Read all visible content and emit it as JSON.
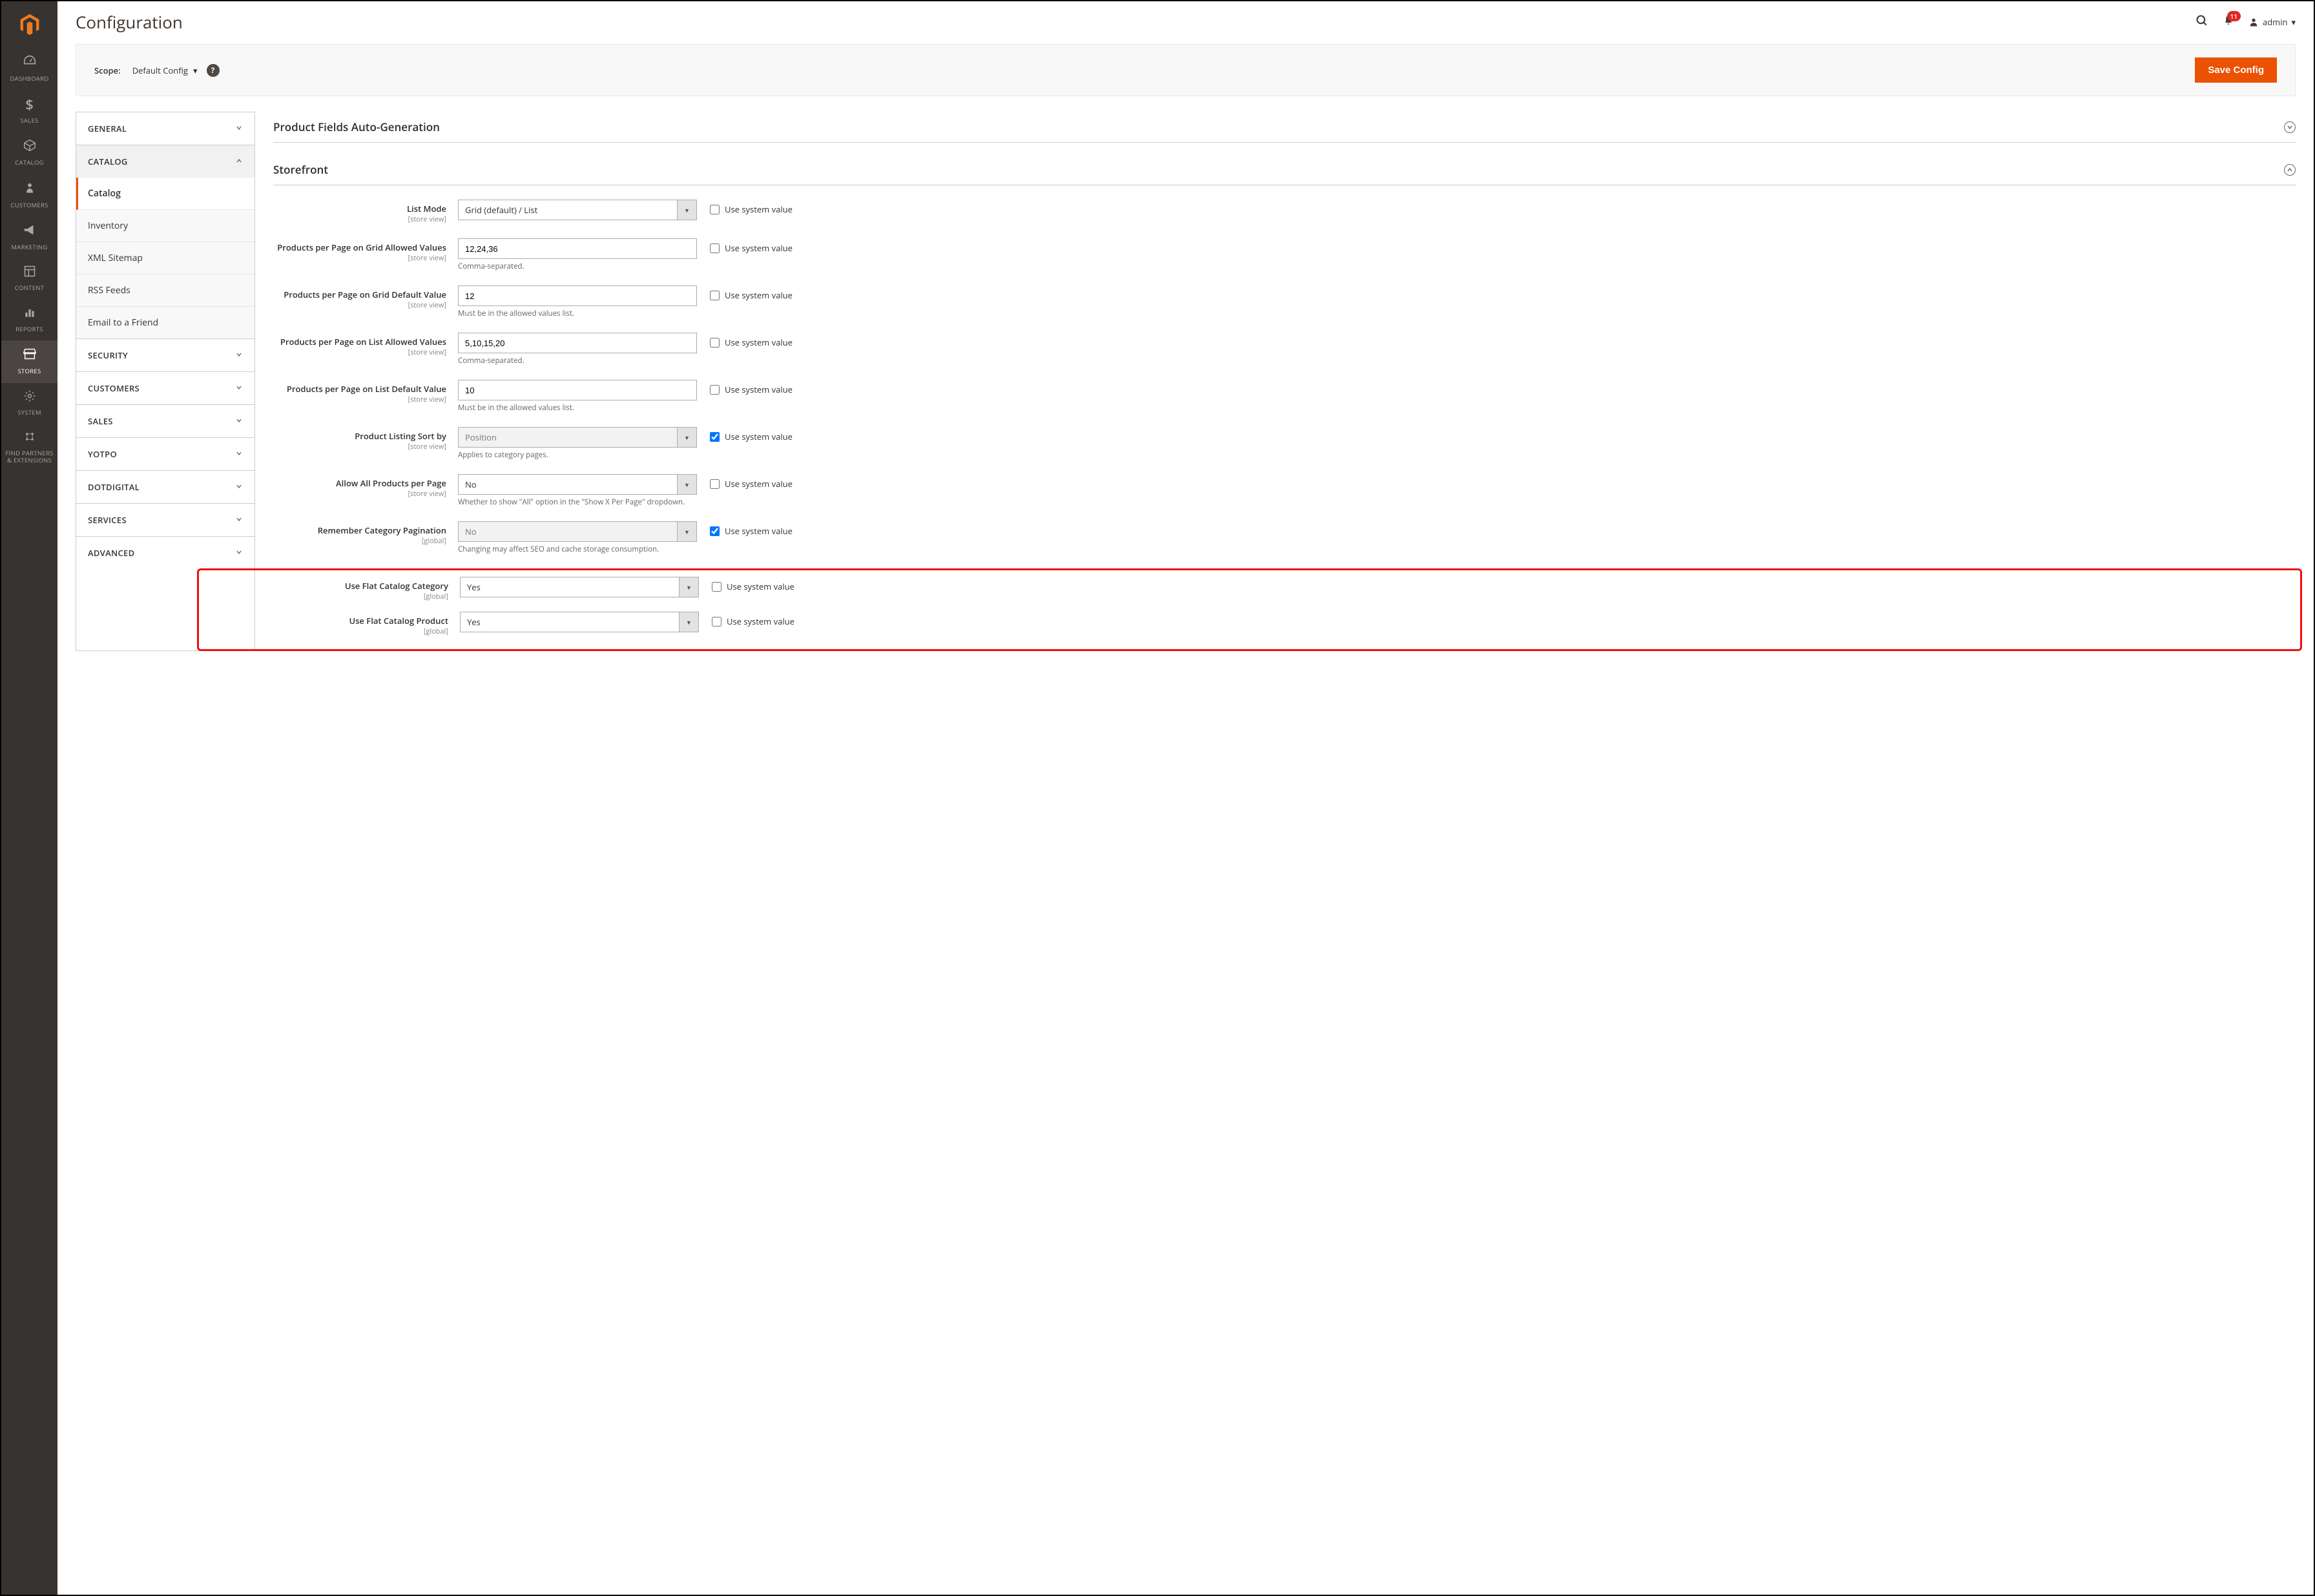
{
  "header": {
    "title": "Configuration",
    "notification_count": "11",
    "admin_label": "admin"
  },
  "scope": {
    "label": "Scope:",
    "value": "Default Config",
    "save_label": "Save Config"
  },
  "sidebar": [
    {
      "key": "dashboard",
      "label": "DASHBOARD"
    },
    {
      "key": "sales",
      "label": "SALES"
    },
    {
      "key": "catalog",
      "label": "CATALOG"
    },
    {
      "key": "customers",
      "label": "CUSTOMERS"
    },
    {
      "key": "marketing",
      "label": "MARKETING"
    },
    {
      "key": "content",
      "label": "CONTENT"
    },
    {
      "key": "reports",
      "label": "REPORTS"
    },
    {
      "key": "stores",
      "label": "STORES",
      "active": true
    },
    {
      "key": "system",
      "label": "SYSTEM"
    },
    {
      "key": "find",
      "label": "FIND PARTNERS & EXTENSIONS"
    }
  ],
  "tabs": [
    {
      "label": "GENERAL",
      "open": false
    },
    {
      "label": "CATALOG",
      "open": true,
      "items": [
        {
          "label": "Catalog",
          "active": true
        },
        {
          "label": "Inventory"
        },
        {
          "label": "XML Sitemap"
        },
        {
          "label": "RSS Feeds"
        },
        {
          "label": "Email to a Friend"
        }
      ]
    },
    {
      "label": "SECURITY",
      "open": false
    },
    {
      "label": "CUSTOMERS",
      "open": false
    },
    {
      "label": "SALES",
      "open": false
    },
    {
      "label": "YOTPO",
      "open": false
    },
    {
      "label": "DOTDIGITAL",
      "open": false
    },
    {
      "label": "SERVICES",
      "open": false
    },
    {
      "label": "ADVANCED",
      "open": false
    }
  ],
  "sections": {
    "auto_gen": {
      "title": "Product Fields Auto-Generation"
    },
    "storefront": {
      "title": "Storefront",
      "use_system_label": "Use system value",
      "fields": {
        "list_mode": {
          "label": "List Mode",
          "scope": "[store view]",
          "value": "Grid (default) / List",
          "use": false,
          "type": "select"
        },
        "grid_allowed": {
          "label": "Products per Page on Grid Allowed Values",
          "scope": "[store view]",
          "value": "12,24,36",
          "note": "Comma-separated.",
          "use": false,
          "type": "text"
        },
        "grid_default": {
          "label": "Products per Page on Grid Default Value",
          "scope": "[store view]",
          "value": "12",
          "note": "Must be in the allowed values list.",
          "use": false,
          "type": "text"
        },
        "list_allowed": {
          "label": "Products per Page on List Allowed Values",
          "scope": "[store view]",
          "value": "5,10,15,20",
          "note": "Comma-separated.",
          "use": false,
          "type": "text"
        },
        "list_default": {
          "label": "Products per Page on List Default Value",
          "scope": "[store view]",
          "value": "10",
          "note": "Must be in the allowed values list.",
          "use": false,
          "type": "text"
        },
        "sort_by": {
          "label": "Product Listing Sort by",
          "scope": "[store view]",
          "value": "Position",
          "note": "Applies to category pages.",
          "use": true,
          "type": "select",
          "disabled": true
        },
        "allow_all": {
          "label": "Allow All Products per Page",
          "scope": "[store view]",
          "value": "No",
          "note": "Whether to show \"All\" option in the \"Show X Per Page\" dropdown.",
          "use": false,
          "type": "select"
        },
        "remember": {
          "label": "Remember Category Pagination",
          "scope": "[global]",
          "value": "No",
          "note": "Changing may affect SEO and cache storage consumption.",
          "use": true,
          "type": "select",
          "disabled": true
        },
        "flat_cat": {
          "label": "Use Flat Catalog Category",
          "scope": "[global]",
          "value": "Yes",
          "use": false,
          "type": "select"
        },
        "flat_prod": {
          "label": "Use Flat Catalog Product",
          "scope": "[global]",
          "value": "Yes",
          "use": false,
          "type": "select"
        }
      }
    }
  }
}
